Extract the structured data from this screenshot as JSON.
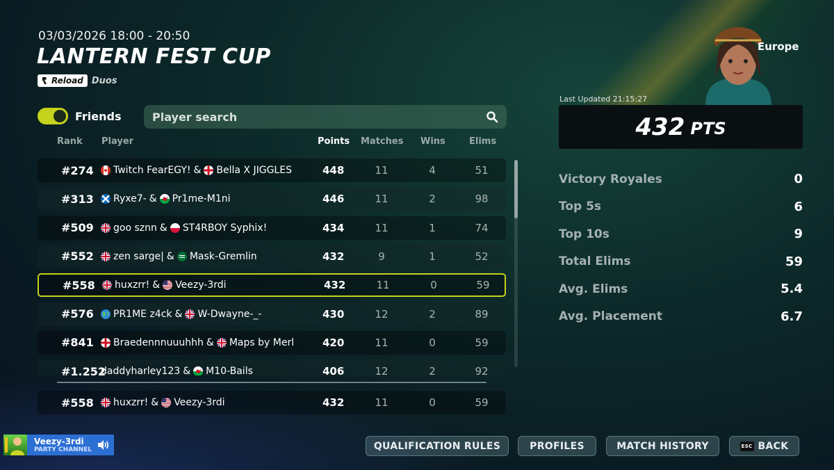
{
  "event": {
    "datetime": "03/03/2026 18:00 - 20:50",
    "title": "LANTERN FEST CUP",
    "mode_badge": "Reload",
    "mode_type": "Duos"
  },
  "filters": {
    "friends_label": "Friends",
    "friends_on": true,
    "search_placeholder": "Player search"
  },
  "table": {
    "headers": {
      "rank": "Rank",
      "player": "Player",
      "points": "Points",
      "matches": "Matches",
      "wins": "Wins",
      "elims": "Elims"
    },
    "rows": [
      {
        "rank": "#274",
        "p1": "Twitch FearEGY!",
        "f1": "ca",
        "p2": "Bella X JIGGLES",
        "f2": "en",
        "points": "448",
        "matches": "11",
        "wins": "4",
        "elims": "51"
      },
      {
        "rank": "#313",
        "p1": "Ryxe7-",
        "f1": "sc",
        "p2": "Pr1me-M1ni",
        "f2": "wa",
        "points": "446",
        "matches": "11",
        "wins": "2",
        "elims": "98"
      },
      {
        "rank": "#509",
        "p1": "goo sznn",
        "f1": "gb",
        "p2": "ST4RBOY Syphix!",
        "f2": "pl",
        "points": "434",
        "matches": "11",
        "wins": "1",
        "elims": "74"
      },
      {
        "rank": "#552",
        "p1": "zen sarge|",
        "f1": "gb",
        "p2": "Mask-Gremlin",
        "f2": "sa",
        "points": "432",
        "matches": "9",
        "wins": "1",
        "elims": "52"
      },
      {
        "rank": "#558",
        "p1": "huxzrr!",
        "f1": "gb",
        "p2": "Veezy-3rdi",
        "f2": "us",
        "points": "432",
        "matches": "11",
        "wins": "0",
        "elims": "59",
        "highlight": true
      },
      {
        "rank": "#576",
        "p1": "PR1ME z4ck",
        "f1": "globe",
        "p2": "W-Dwayne-_-",
        "f2": "gb",
        "points": "430",
        "matches": "12",
        "wins": "2",
        "elims": "89"
      },
      {
        "rank": "#841",
        "p1": "Braedennnuuuhhh",
        "f1": "en",
        "p2": "Maps by Merl",
        "f2": "gb",
        "points": "420",
        "matches": "11",
        "wins": "0",
        "elims": "59"
      },
      {
        "rank": "#1.252",
        "p1": "daddyharley123",
        "f1": "",
        "p2": "M10-Bails",
        "f2": "wa",
        "points": "406",
        "matches": "12",
        "wins": "2",
        "elims": "92"
      }
    ],
    "self_row": {
      "rank": "#558",
      "p1": "huxzrr!",
      "f1": "gb",
      "p2": "Veezy-3rdi",
      "f2": "us",
      "points": "432",
      "matches": "11",
      "wins": "0",
      "elims": "59"
    }
  },
  "summary": {
    "region": "Europe",
    "last_updated": "Last Updated 21:15:27",
    "points": "432",
    "points_unit": "PTS",
    "stats": [
      {
        "label": "Victory Royales",
        "value": "0"
      },
      {
        "label": "Top 5s",
        "value": "6"
      },
      {
        "label": "Top 10s",
        "value": "9"
      },
      {
        "label": "Total Elims",
        "value": "59"
      },
      {
        "label": "Avg. Elims",
        "value": "5.4"
      },
      {
        "label": "Avg. Placement",
        "value": "6.7"
      }
    ]
  },
  "party": {
    "name": "Veezy-3rdi",
    "channel": "PARTY CHANNEL"
  },
  "buttons": {
    "qualification": "QUALIFICATION RULES",
    "profiles": "PROFILES",
    "match_history": "MATCH HISTORY",
    "back": "BACK",
    "back_key": "ESC"
  },
  "colors": {
    "accent": "#c5d31c",
    "party": "#2c6fd3"
  }
}
